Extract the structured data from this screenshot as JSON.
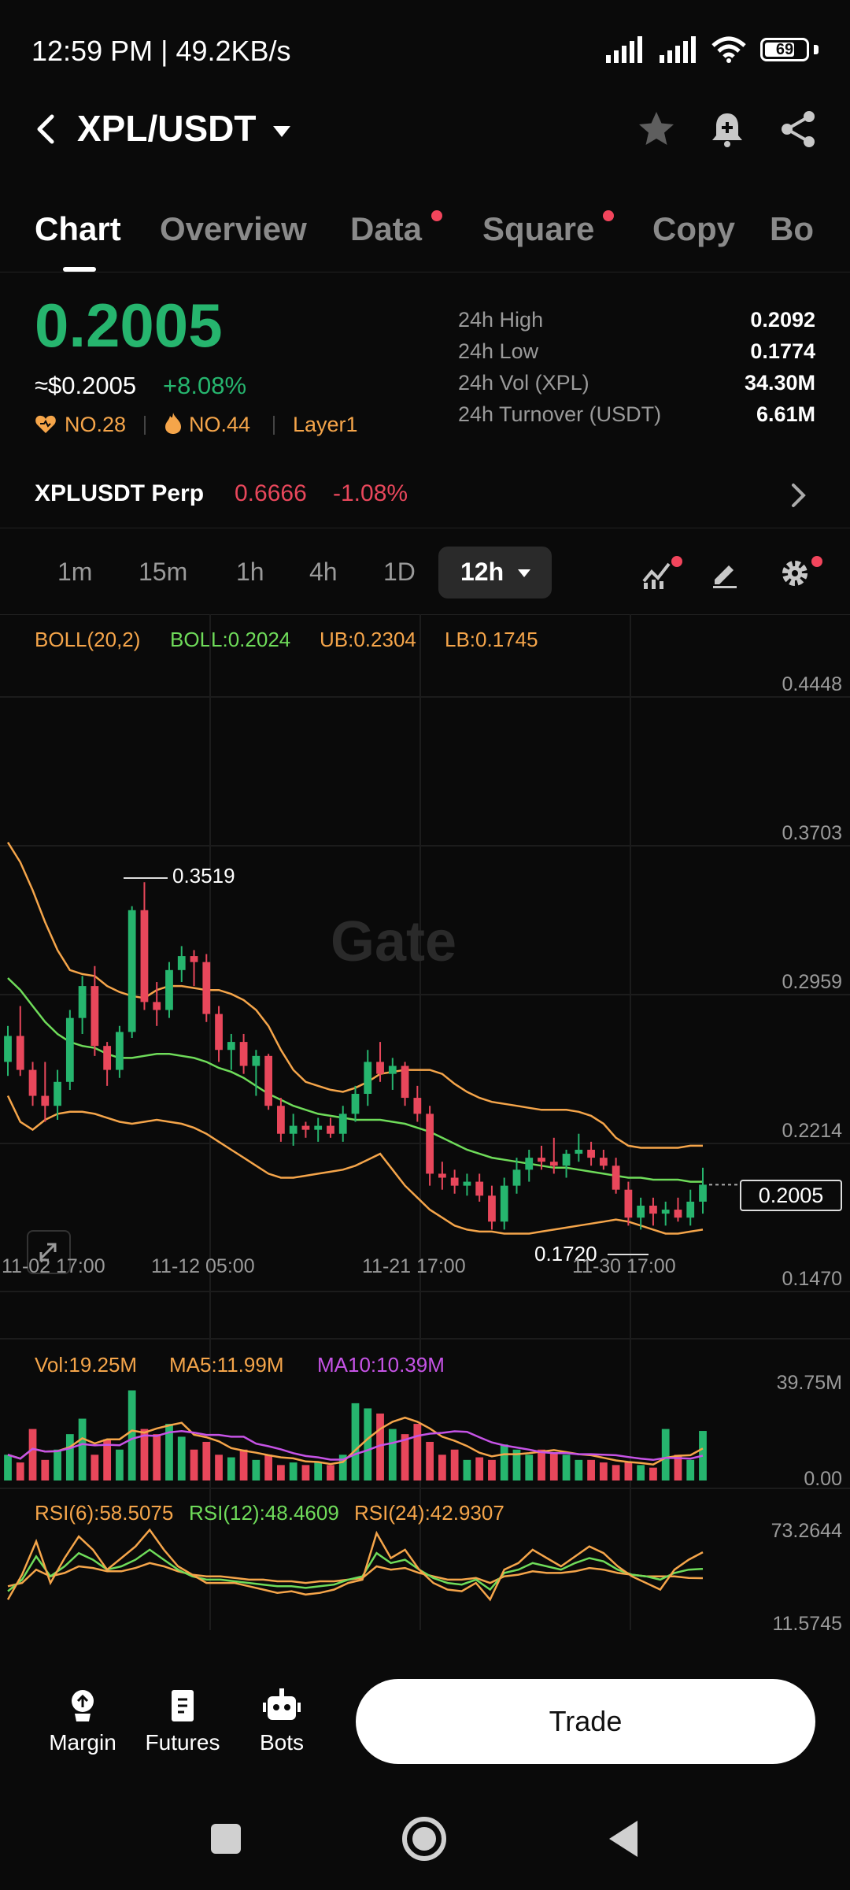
{
  "status_bar": {
    "time": "12:59 PM | 49.2KB/s",
    "battery": "69"
  },
  "header": {
    "pair": "XPL/USDT"
  },
  "tabs": [
    {
      "label": "Chart",
      "active": true
    },
    {
      "label": "Overview"
    },
    {
      "label": "Data",
      "dot": true
    },
    {
      "label": "Square",
      "dot": true
    },
    {
      "label": "Copy"
    },
    {
      "label": "Bo"
    }
  ],
  "price": {
    "last": "0.2005",
    "usd": "≈$0.2005",
    "change": "+8.08%",
    "tags": [
      "NO.28",
      "NO.44",
      "Layer1"
    ]
  },
  "stats": [
    {
      "label": "24h High",
      "value": "0.2092"
    },
    {
      "label": "24h Low",
      "value": "0.1774"
    },
    {
      "label": "24h Vol (XPL)",
      "value": "34.30M"
    },
    {
      "label": "24h Turnover (USDT)",
      "value": "6.61M"
    }
  ],
  "perp": {
    "name": "XPLUSDT Perp",
    "price": "0.6666",
    "change": "-1.08%"
  },
  "timeframes": [
    "1m",
    "15m",
    "1h",
    "4h",
    "1D"
  ],
  "timeframe_active": "12h",
  "indicators": {
    "boll_name": "BOLL(20,2)",
    "boll_mid": "BOLL:0.2024",
    "boll_ub": "UB:0.2304",
    "boll_lb": "LB:0.1745",
    "vol": "Vol:19.25M",
    "ma5": "MA5:11.99M",
    "ma10": "MA10:10.39M",
    "rsi6": "RSI(6):58.5075",
    "rsi12": "RSI(12):48.4609",
    "rsi24": "RSI(24):42.9307"
  },
  "watermark": "Gate",
  "price_axis": [
    "0.4448",
    "0.3703",
    "0.2959",
    "0.2214",
    "0.1470"
  ],
  "current_price_tag": "0.2005",
  "annotations": {
    "high": "0.3519",
    "low": "0.1720"
  },
  "time_axis": [
    "11-02 17:00",
    "11-12 05:00",
    "11-21 17:00",
    "11-30 17:00"
  ],
  "volume_axis": [
    "39.75M",
    "0.00"
  ],
  "rsi_axis": [
    "73.2644",
    "11.5745"
  ],
  "bottom_nav": [
    {
      "label": "Margin"
    },
    {
      "label": "Futures"
    },
    {
      "label": "Bots"
    }
  ],
  "trade_label": "Trade",
  "colors": {
    "up": "#26b56e",
    "down": "#e8475b",
    "boll_band": "#f5a54a",
    "boll_mid": "#6fdc5a",
    "ma10": "#c653e6"
  },
  "chart_data": {
    "type": "candlestick",
    "interval": "12h",
    "ylim": [
      0.147,
      0.4448
    ],
    "candles": [
      [
        0.262,
        0.28,
        0.255,
        0.275
      ],
      [
        0.275,
        0.29,
        0.255,
        0.258
      ],
      [
        0.258,
        0.262,
        0.24,
        0.245
      ],
      [
        0.245,
        0.262,
        0.232,
        0.24
      ],
      [
        0.24,
        0.258,
        0.233,
        0.252
      ],
      [
        0.252,
        0.288,
        0.248,
        0.284
      ],
      [
        0.284,
        0.305,
        0.276,
        0.3
      ],
      [
        0.3,
        0.31,
        0.265,
        0.27
      ],
      [
        0.27,
        0.272,
        0.25,
        0.258
      ],
      [
        0.258,
        0.28,
        0.254,
        0.277
      ],
      [
        0.277,
        0.34,
        0.274,
        0.338
      ],
      [
        0.338,
        0.352,
        0.288,
        0.292
      ],
      [
        0.292,
        0.302,
        0.28,
        0.288
      ],
      [
        0.288,
        0.312,
        0.284,
        0.308
      ],
      [
        0.308,
        0.32,
        0.302,
        0.315
      ],
      [
        0.315,
        0.318,
        0.3,
        0.312
      ],
      [
        0.312,
        0.316,
        0.282,
        0.286
      ],
      [
        0.286,
        0.29,
        0.262,
        0.268
      ],
      [
        0.268,
        0.276,
        0.258,
        0.272
      ],
      [
        0.272,
        0.276,
        0.256,
        0.26
      ],
      [
        0.26,
        0.268,
        0.245,
        0.265
      ],
      [
        0.265,
        0.266,
        0.238,
        0.24
      ],
      [
        0.24,
        0.244,
        0.222,
        0.226
      ],
      [
        0.226,
        0.236,
        0.22,
        0.23
      ],
      [
        0.23,
        0.232,
        0.224,
        0.228
      ],
      [
        0.228,
        0.234,
        0.222,
        0.23
      ],
      [
        0.23,
        0.234,
        0.224,
        0.226
      ],
      [
        0.226,
        0.24,
        0.222,
        0.236
      ],
      [
        0.236,
        0.25,
        0.232,
        0.246
      ],
      [
        0.246,
        0.268,
        0.24,
        0.262
      ],
      [
        0.262,
        0.272,
        0.252,
        0.256
      ],
      [
        0.256,
        0.264,
        0.248,
        0.26
      ],
      [
        0.26,
        0.262,
        0.24,
        0.244
      ],
      [
        0.244,
        0.25,
        0.232,
        0.236
      ],
      [
        0.236,
        0.24,
        0.2,
        0.206
      ],
      [
        0.206,
        0.212,
        0.198,
        0.204
      ],
      [
        0.204,
        0.208,
        0.196,
        0.2
      ],
      [
        0.2,
        0.206,
        0.195,
        0.202
      ],
      [
        0.202,
        0.206,
        0.192,
        0.195
      ],
      [
        0.195,
        0.2,
        0.178,
        0.182
      ],
      [
        0.182,
        0.204,
        0.178,
        0.2
      ],
      [
        0.2,
        0.214,
        0.196,
        0.208
      ],
      [
        0.208,
        0.218,
        0.202,
        0.214
      ],
      [
        0.214,
        0.22,
        0.208,
        0.212
      ],
      [
        0.212,
        0.224,
        0.206,
        0.21
      ],
      [
        0.21,
        0.218,
        0.204,
        0.216
      ],
      [
        0.216,
        0.226,
        0.212,
        0.218
      ],
      [
        0.218,
        0.222,
        0.21,
        0.214
      ],
      [
        0.214,
        0.218,
        0.208,
        0.21
      ],
      [
        0.21,
        0.214,
        0.196,
        0.198
      ],
      [
        0.198,
        0.202,
        0.18,
        0.184
      ],
      [
        0.184,
        0.194,
        0.178,
        0.19
      ],
      [
        0.19,
        0.194,
        0.18,
        0.186
      ],
      [
        0.186,
        0.192,
        0.18,
        0.188
      ],
      [
        0.188,
        0.194,
        0.182,
        0.184
      ],
      [
        0.184,
        0.198,
        0.18,
        0.192
      ],
      [
        0.192,
        0.209,
        0.186,
        0.2005
      ]
    ],
    "boll_upper": [
      0.372,
      0.362,
      0.348,
      0.332,
      0.318,
      0.308,
      0.306,
      0.305,
      0.3,
      0.297,
      0.295,
      0.294,
      0.298,
      0.3,
      0.3,
      0.299,
      0.298,
      0.298,
      0.296,
      0.293,
      0.288,
      0.28,
      0.268,
      0.258,
      0.252,
      0.25,
      0.248,
      0.247,
      0.249,
      0.252,
      0.256,
      0.257,
      0.258,
      0.258,
      0.258,
      0.256,
      0.251,
      0.247,
      0.244,
      0.242,
      0.241,
      0.24,
      0.239,
      0.238,
      0.238,
      0.238,
      0.237,
      0.235,
      0.231,
      0.224,
      0.22,
      0.219,
      0.219,
      0.219,
      0.219,
      0.22,
      0.22
    ],
    "boll_mid": [
      0.304,
      0.298,
      0.29,
      0.282,
      0.276,
      0.272,
      0.27,
      0.269,
      0.266,
      0.264,
      0.264,
      0.265,
      0.266,
      0.266,
      0.265,
      0.264,
      0.262,
      0.259,
      0.257,
      0.254,
      0.25,
      0.246,
      0.243,
      0.24,
      0.238,
      0.236,
      0.235,
      0.234,
      0.233,
      0.233,
      0.233,
      0.232,
      0.231,
      0.229,
      0.227,
      0.224,
      0.221,
      0.218,
      0.216,
      0.214,
      0.213,
      0.212,
      0.211,
      0.21,
      0.209,
      0.209,
      0.208,
      0.207,
      0.206,
      0.205,
      0.204,
      0.204,
      0.203,
      0.203,
      0.203,
      0.202,
      0.202
    ],
    "boll_lower": [
      0.245,
      0.232,
      0.228,
      0.233,
      0.236,
      0.237,
      0.237,
      0.236,
      0.234,
      0.232,
      0.231,
      0.232,
      0.233,
      0.232,
      0.231,
      0.229,
      0.226,
      0.222,
      0.218,
      0.214,
      0.21,
      0.206,
      0.204,
      0.204,
      0.205,
      0.206,
      0.207,
      0.208,
      0.21,
      0.213,
      0.216,
      0.208,
      0.2,
      0.194,
      0.188,
      0.184,
      0.18,
      0.178,
      0.177,
      0.177,
      0.176,
      0.176,
      0.176,
      0.177,
      0.178,
      0.179,
      0.18,
      0.181,
      0.182,
      0.183,
      0.182,
      0.18,
      0.178,
      0.176,
      0.176,
      0.177,
      0.178
    ],
    "volume": [
      10,
      7,
      20,
      8,
      12,
      18,
      24,
      10,
      16,
      12,
      35,
      20,
      18,
      22,
      17,
      12,
      15,
      10,
      9,
      12,
      8,
      10,
      6,
      7,
      6,
      7,
      6,
      10,
      30,
      28,
      26,
      20,
      18,
      22,
      15,
      10,
      12,
      8,
      9,
      8,
      14,
      12,
      10,
      12,
      11,
      10,
      8,
      8,
      7,
      6,
      7,
      6,
      5,
      20,
      10,
      8,
      19.25
    ],
    "rsi6": [
      30,
      45,
      65,
      40,
      55,
      68,
      60,
      48,
      55,
      62,
      72,
      60,
      50,
      45,
      40,
      40,
      40,
      38,
      36,
      34,
      35,
      33,
      34,
      36,
      40,
      42,
      70,
      55,
      60,
      48,
      40,
      36,
      35,
      40,
      30,
      48,
      52,
      60,
      55,
      50,
      56,
      62,
      58,
      50,
      44,
      40,
      36,
      48,
      54,
      58.5
    ],
    "rsi12": [
      35,
      42,
      56,
      44,
      50,
      58,
      54,
      48,
      50,
      54,
      60,
      54,
      48,
      44,
      42,
      42,
      41,
      40,
      39,
      38,
      38,
      37,
      38,
      39,
      42,
      44,
      58,
      52,
      54,
      48,
      43,
      40,
      39,
      42,
      36,
      46,
      48,
      52,
      50,
      48,
      52,
      55,
      53,
      48,
      45,
      44,
      42,
      46,
      48,
      48.5
    ],
    "rsi24": [
      38,
      40,
      48,
      44,
      46,
      50,
      49,
      47,
      47,
      49,
      52,
      50,
      47,
      45,
      44,
      44,
      43,
      42,
      42,
      41,
      41,
      40,
      41,
      41,
      42,
      43,
      50,
      48,
      49,
      46,
      44,
      42,
      42,
      43,
      40,
      44,
      45,
      47,
      46,
      46,
      47,
      49,
      48,
      46,
      45,
      44,
      44,
      44,
      43,
      42.9
    ]
  }
}
